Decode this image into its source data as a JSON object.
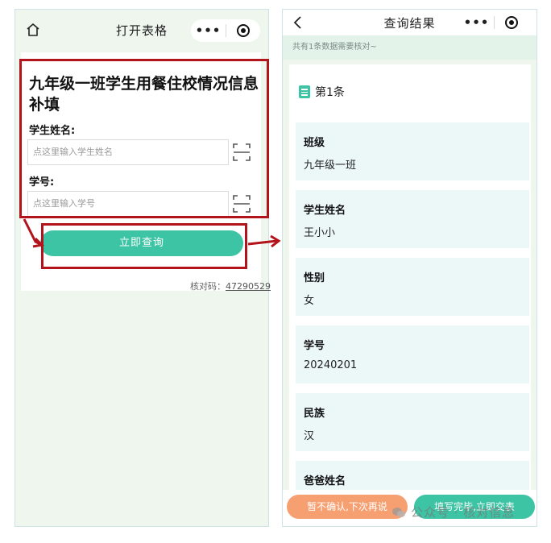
{
  "left_phone": {
    "nav_title": "打开表格",
    "capsule_more": "•••",
    "form": {
      "title": "九年级一班学生用餐住校情况信息补填",
      "name_label": "学生姓名:",
      "name_placeholder": "点这里输入学生姓名",
      "id_label": "学号:",
      "id_placeholder": "点这里输入学号"
    },
    "query_button": "立即查询",
    "verify_label": "核对码：",
    "verify_code": "47290529"
  },
  "right_phone": {
    "nav_title": "查询结果",
    "capsule_more": "•••",
    "hint": "共有1条数据需要核对~",
    "record_title": "第1条",
    "fields": [
      {
        "key": "班级",
        "value": "九年级一班"
      },
      {
        "key": "学生姓名",
        "value": "王小小"
      },
      {
        "key": "性别",
        "value": "女"
      },
      {
        "key": "学号",
        "value": "20240201"
      },
      {
        "key": "民族",
        "value": "汉"
      },
      {
        "key": "爸爸姓名",
        "value": ""
      }
    ],
    "btn_later": "暂不确认,下次再说",
    "btn_submit": "填写完毕,立即交表"
  },
  "watermark": "公众号 · 核对信息",
  "colors": {
    "accent": "#3cc4a4",
    "orange": "#f6a072",
    "highlight_red": "#b3141b",
    "page_bg": "#eef6ee"
  },
  "icons": [
    "home-icon",
    "more-icon",
    "target-icon",
    "scan-icon",
    "back-icon",
    "doc-icon",
    "arrow-icon"
  ]
}
